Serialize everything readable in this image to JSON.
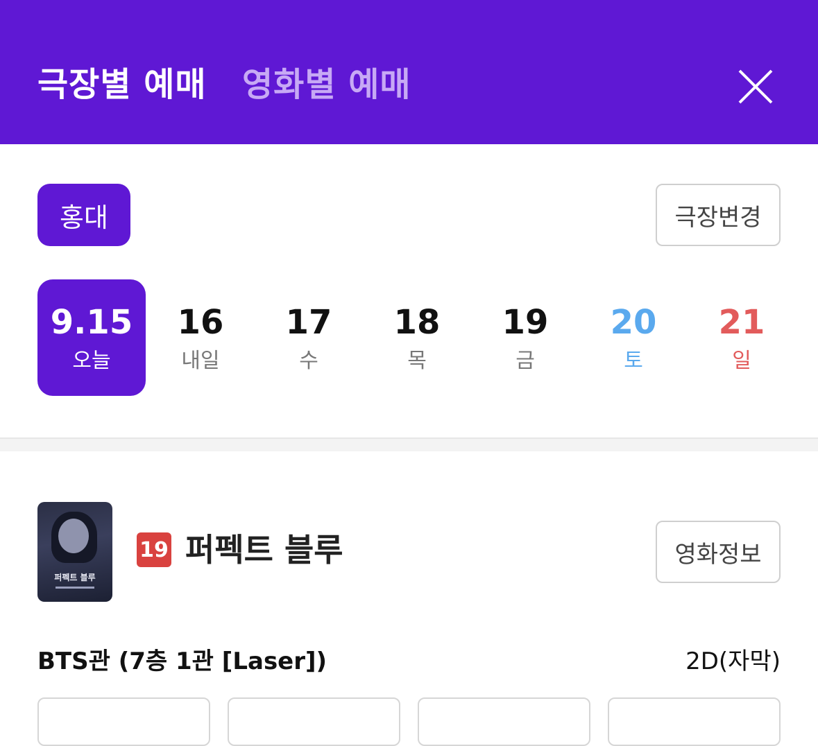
{
  "colors": {
    "accent": "#5f18d4",
    "saturday": "#5aa9ee",
    "sunday": "#e25b5b"
  },
  "header": {
    "tabs": [
      {
        "label": "극장별 예매",
        "active": true
      },
      {
        "label": "영화별 예매",
        "active": false
      }
    ],
    "close_icon": "close-icon"
  },
  "theater": {
    "selected": "홍대",
    "change_label": "극장변경"
  },
  "dates": [
    {
      "num": "9.15",
      "day": "오늘",
      "selected": true
    },
    {
      "num": "16",
      "day": "내일"
    },
    {
      "num": "17",
      "day": "수"
    },
    {
      "num": "18",
      "day": "목"
    },
    {
      "num": "19",
      "day": "금"
    },
    {
      "num": "20",
      "day": "토"
    },
    {
      "num": "21",
      "day": "일"
    }
  ],
  "movie": {
    "poster_title": "퍼펙트 블루",
    "rating": "19",
    "title": "퍼펙트 블루",
    "info_label": "영화정보",
    "hall": "BTS관 (7층 1관 [Laser])",
    "format": "2D(자막)"
  }
}
